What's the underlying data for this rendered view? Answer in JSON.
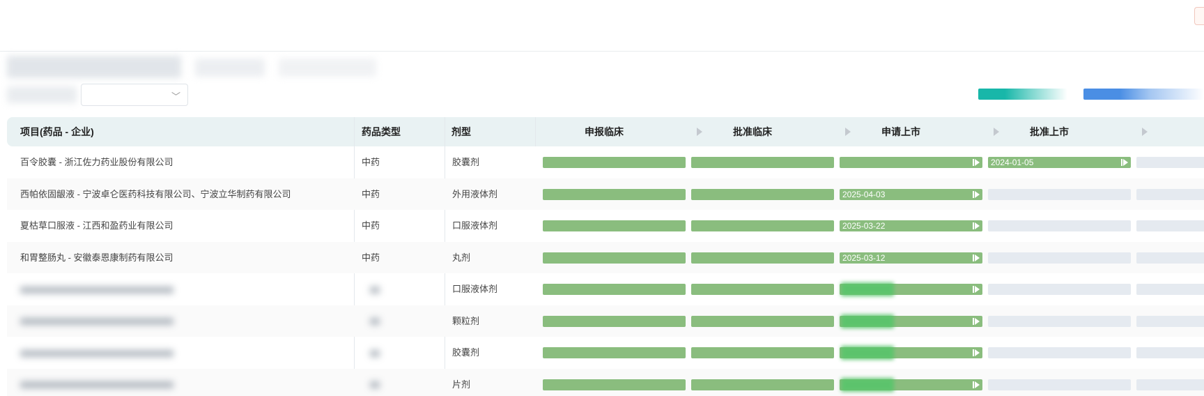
{
  "table": {
    "headers": {
      "project": "项目(药品 - 企业)",
      "drug_type": "药品类型",
      "dosage_form": "剂型"
    },
    "stages": [
      "申报临床",
      "批准临床",
      "申请上市",
      "批准上市"
    ],
    "rows": [
      {
        "project": "百令胶囊 - 浙江佐力药业股份有限公司",
        "type": "中药",
        "form": "胶囊剂",
        "completed": 3,
        "date": "2024-01-05",
        "date_stage": 3,
        "blurred": false
      },
      {
        "project": "西帕依固龈液 - 宁波卓仑医药科技有限公司、宁波立华制药有限公司",
        "type": "中药",
        "form": "外用液体剂",
        "completed": 2,
        "date": "2025-04-03",
        "date_stage": 2,
        "blurred": false
      },
      {
        "project": "夏枯草口服液 - 江西和盈药业有限公司",
        "type": "中药",
        "form": "口服液体剂",
        "completed": 2,
        "date": "2025-03-22",
        "date_stage": 2,
        "blurred": false
      },
      {
        "project": "和胃整肠丸 - 安徽泰恩康制药有限公司",
        "type": "中药",
        "form": "丸剂",
        "completed": 2,
        "date": "2025-03-12",
        "date_stage": 2,
        "blurred": false
      },
      {
        "project": "",
        "type": "",
        "form": "口服液体剂",
        "completed": 2,
        "date": "",
        "date_stage": 2,
        "blurred": true
      },
      {
        "project": "",
        "type": "",
        "form": "颗粒剂",
        "completed": 2,
        "date": "",
        "date_stage": 2,
        "blurred": true
      },
      {
        "project": "",
        "type": "",
        "form": "胶囊剂",
        "completed": 2,
        "date": "",
        "date_stage": 2,
        "blurred": true
      },
      {
        "project": "",
        "type": "",
        "form": "片剂",
        "completed": 2,
        "date": "",
        "date_stage": 2,
        "blurred": true
      }
    ]
  },
  "colors": {
    "bar_done": "#8abd7e",
    "bar_empty": "#e5eaf0",
    "header_bg": "#e9f2f3",
    "legend_teal": "#18b7a9",
    "legend_blue": "#4a8ee4"
  },
  "icons": {
    "select_caret": "chevron-down-icon",
    "stage_arrow": "triangle-right-icon",
    "bar_end": "play-end-icon"
  }
}
